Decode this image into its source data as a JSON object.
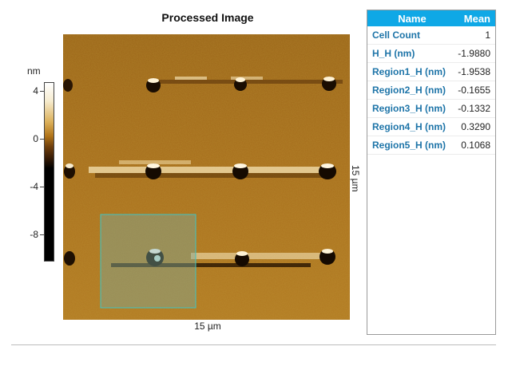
{
  "title": "Processed Image",
  "colorbar": {
    "unit": "nm",
    "ticks": [
      {
        "label": "4",
        "value": 4
      },
      {
        "label": "0",
        "value": 0
      },
      {
        "label": "-4",
        "value": -4
      },
      {
        "label": "-8",
        "value": -8
      }
    ]
  },
  "image": {
    "x_label": "15 µm",
    "y_label": "15 µm",
    "roi_color": "#3fc4c4"
  },
  "table": {
    "header_name": "Name",
    "header_mean": "Mean",
    "header_color": "#0fa8e6",
    "name_color": "#1d74a8",
    "rows": [
      {
        "name": "Cell Count",
        "mean": "1"
      },
      {
        "name": "H_H (nm)",
        "mean": "-1.9880"
      },
      {
        "name": "Region1_H (nm)",
        "mean": "-1.9538"
      },
      {
        "name": "Region2_H (nm)",
        "mean": "-0.1655"
      },
      {
        "name": "Region3_H (nm)",
        "mean": "-0.1332"
      },
      {
        "name": "Region4_H (nm)",
        "mean": "0.3290"
      },
      {
        "name": "Region5_H (nm)",
        "mean": "0.1068"
      }
    ]
  }
}
